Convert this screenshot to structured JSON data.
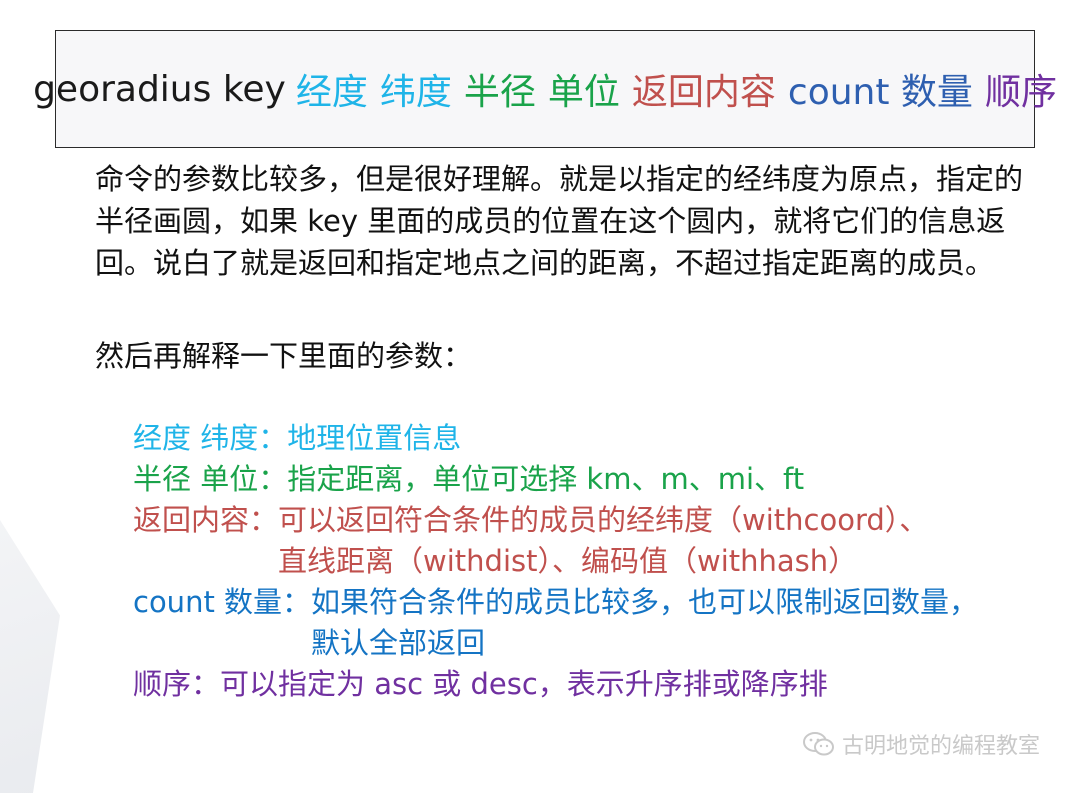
{
  "title": {
    "command": "georadius key",
    "parts": {
      "lng": "经度",
      "lat": "纬度",
      "radius": "半径",
      "unit": "单位",
      "ret": "返回内容",
      "count": "count 数量",
      "order": "顺序"
    }
  },
  "description": "命令的参数比较多，但是很好理解。就是以指定的经纬度为原点，指定的半径画圆，如果 key 里面的成员的位置在这个圆内，就将它们的信息返回。说白了就是返回和指定地点之间的距离，不超过指定距离的成员。",
  "intro": "然后再解释一下里面的参数：",
  "params": [
    {
      "key": "经度 纬度：",
      "value": "地理位置信息"
    },
    {
      "key": "半径 单位：",
      "value": "指定距离，单位可选择 km、m、mi、ft"
    },
    {
      "key": "返回内容：",
      "value": "可以返回符合条件的成员的经纬度（withcoord）、\n直线距离（withdist）、编码值（withhash）"
    },
    {
      "key": "count 数量：",
      "value": "如果符合条件的成员比较多，也可以限制返回数量，\n默认全部返回"
    },
    {
      "key": "顺序：",
      "value": "可以指定为 asc 或 desc，表示升序排或降序排"
    }
  ],
  "watermark": "古明地觉的编程教室",
  "colors": {
    "lng_lat": "#1fb4e8",
    "radius_unit": "#1aa34a",
    "ret": "#c0504d",
    "count_title": "#2e5fb0",
    "count_param": "#1474c4",
    "order": "#7030a0"
  },
  "icons": {
    "watermark": "wechat-icon"
  }
}
